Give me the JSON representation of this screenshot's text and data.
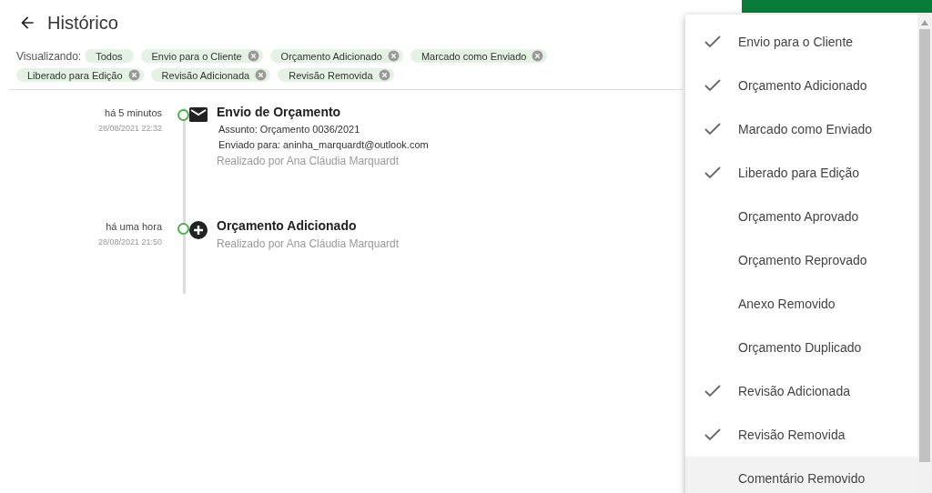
{
  "header": {
    "title": "Histórico"
  },
  "filters": {
    "label": "Visualizando:",
    "chips": [
      {
        "label": "Todos",
        "removable": false
      },
      {
        "label": "Envio para o Cliente",
        "removable": true
      },
      {
        "label": "Orçamento Adicionado",
        "removable": true
      },
      {
        "label": "Marcado como Enviado",
        "removable": true
      },
      {
        "label": "Liberado para Edição",
        "removable": true
      },
      {
        "label": "Revisão Adicionada",
        "removable": true
      },
      {
        "label": "Revisão Removida",
        "removable": true
      }
    ]
  },
  "timeline": [
    {
      "kind": "email",
      "relative": "há 5 minutos",
      "date": "28/08/2021 22:32",
      "title": "Envio de Orçamento",
      "details": [
        "Assunto: Orçamento 0036/2021",
        "Enviado para: aninha_marquardt@outlook.com"
      ],
      "author": "Realizado por Ana Cláudia Marquardt"
    },
    {
      "kind": "add",
      "relative": "há uma hora",
      "date": "28/08/2021 21:50",
      "title": "Orçamento Adicionado",
      "author": "Realizado por Ana Cláudia Marquardt"
    }
  ],
  "menu": {
    "items": [
      {
        "label": "Envio para o Cliente",
        "checked": true,
        "highlighted": false
      },
      {
        "label": "Orçamento Adicionado",
        "checked": true,
        "highlighted": false
      },
      {
        "label": "Marcado como Enviado",
        "checked": true,
        "highlighted": false
      },
      {
        "label": "Liberado para Edição",
        "checked": true,
        "highlighted": false
      },
      {
        "label": "Orçamento Aprovado",
        "checked": false,
        "highlighted": false
      },
      {
        "label": "Orçamento Reprovado",
        "checked": false,
        "highlighted": false
      },
      {
        "label": "Anexo Removido",
        "checked": false,
        "highlighted": false
      },
      {
        "label": "Orçamento Duplicado",
        "checked": false,
        "highlighted": false
      },
      {
        "label": "Revisão Adicionada",
        "checked": true,
        "highlighted": false
      },
      {
        "label": "Revisão Removida",
        "checked": true,
        "highlighted": false
      },
      {
        "label": "Comentário Removido",
        "checked": false,
        "highlighted": true
      }
    ]
  }
}
